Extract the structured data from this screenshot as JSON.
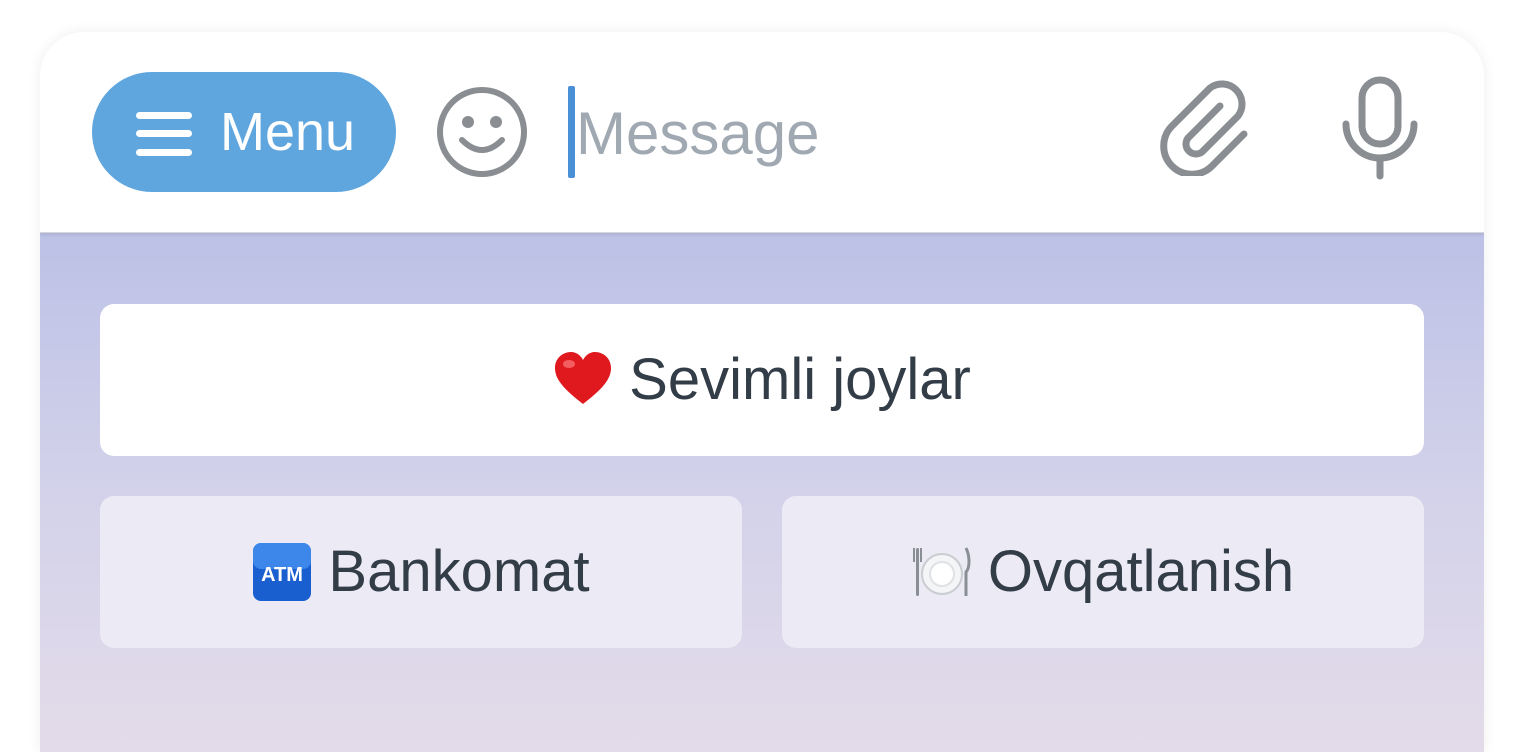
{
  "input_bar": {
    "menu_label": "Menu",
    "message_placeholder": "Message",
    "icons": {
      "menu": "hamburger-icon",
      "emoji": "smiley-icon",
      "attach": "paperclip-icon",
      "mic": "microphone-icon"
    },
    "colors": {
      "menu_button": "#5fa6df",
      "caret": "#4a90d6",
      "icon_gray": "#8a8d91"
    }
  },
  "keyboard": {
    "rows": [
      [
        {
          "icon": "red-heart-emoji",
          "label": "Sevimli joylar"
        }
      ],
      [
        {
          "icon": "atm-sign-emoji",
          "label": "Bankomat"
        },
        {
          "icon": "fork-knife-plate-emoji",
          "label": "Ovqatlanish"
        }
      ]
    ]
  }
}
